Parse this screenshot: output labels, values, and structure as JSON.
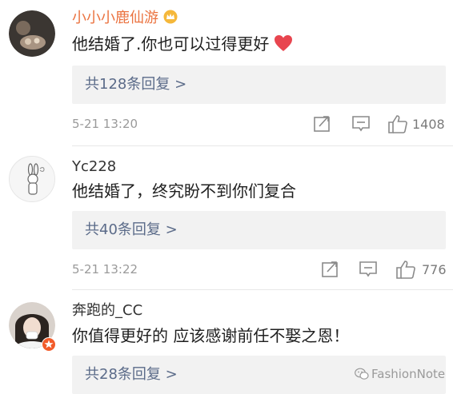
{
  "comments": [
    {
      "username": "小小小鹿仙游",
      "text": "他结婚了.你也可以过得更好",
      "replies": "共128条回复 >",
      "time": "5-21 13:20",
      "likes": "1408"
    },
    {
      "username": "Yc228",
      "text": "他结婚了，终究盼不到你们复合",
      "replies": "共40条回复 >",
      "time": "5-21 13:22",
      "likes": "776"
    },
    {
      "username": "奔跑的_CC",
      "text": "你值得更好的 应该感谢前任不娶之恩！",
      "replies": "共28条回复 >"
    }
  ],
  "icons": {
    "vip_badge": "vip-crown-icon",
    "heart": "red-heart-emoji-icon",
    "forward": "forward-icon",
    "comment": "comment-icon",
    "like": "thumbs-up-icon",
    "watermark": "wechat-icon"
  },
  "colors": {
    "vip_username": "#eb7340",
    "reply_link": "#5b6b89",
    "reply_box_bg": "#f2f2f2",
    "heart": "#e8454f",
    "muted": "#9a9a9a"
  },
  "watermark": {
    "text": "FashionNote"
  }
}
